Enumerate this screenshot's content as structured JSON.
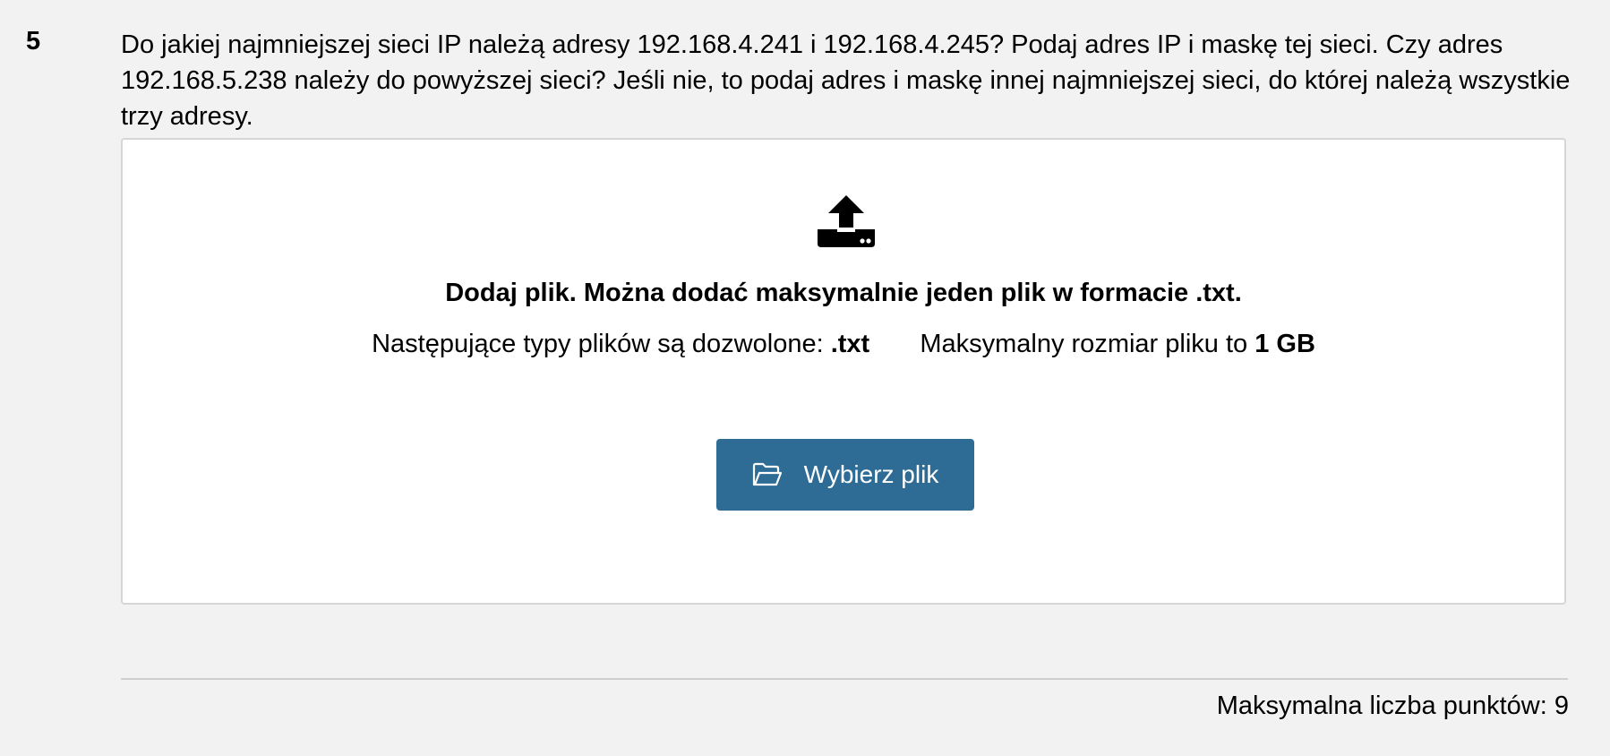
{
  "question": {
    "number": "5",
    "text": "Do jakiej najmniejszej sieci IP należą adresy 192.168.4.241 i 192.168.4.245? Podaj adres IP i maskę tej sieci. Czy adres 192.168.5.238 należy do powyższej sieci? Jeśli nie, to podaj adres i maskę innej najmniejszej sieci, do której należą wszystkie trzy adresy."
  },
  "upload": {
    "icon": "upload-icon",
    "title": "Dodaj plik. Można dodać maksymalnie jeden plik w formacie .txt.",
    "allowed_types_label": "Następujące typy plików są dozwolone:",
    "allowed_types_value": ".txt",
    "max_size_label": "Maksymalny rozmiar pliku to",
    "max_size_value": "1 GB",
    "button_label": "Wybierz plik",
    "button_icon": "folder-open-icon",
    "button_color": "#2e6c96"
  },
  "footer": {
    "max_points": "Maksymalna liczba punktów: 9"
  }
}
